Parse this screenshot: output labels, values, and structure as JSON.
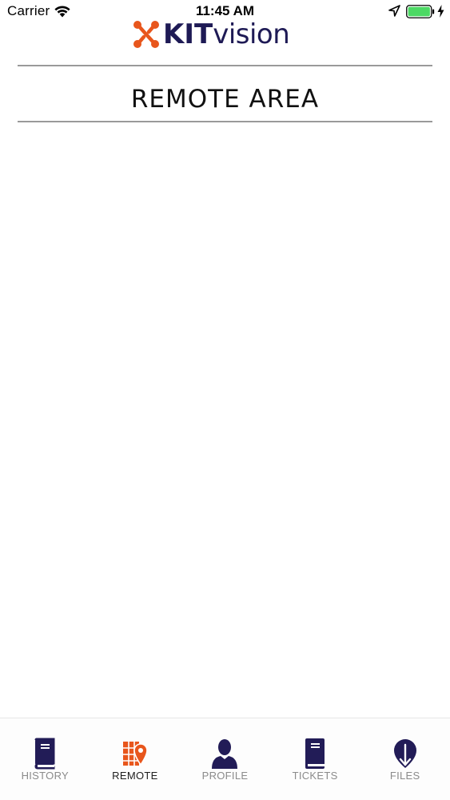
{
  "status_bar": {
    "carrier": "Carrier",
    "time": "11:45 AM"
  },
  "logo": {
    "text_bold": "KIT",
    "text_regular": "vision",
    "text_color": "#1e1a55",
    "mark_color": "#e8561c"
  },
  "header": {
    "title": "REMOTE AREA"
  },
  "tab_bar": {
    "active_tab": "REMOTE",
    "active_color": "#e8561c",
    "inactive_icon_color": "#221c57",
    "tabs": [
      {
        "label": "HISTORY",
        "icon": "book-icon"
      },
      {
        "label": "REMOTE",
        "icon": "map-pin-icon"
      },
      {
        "label": "PROFILE",
        "icon": "user-icon"
      },
      {
        "label": "TICKETS",
        "icon": "book-icon"
      },
      {
        "label": "FILES",
        "icon": "download-pin-icon"
      }
    ]
  }
}
